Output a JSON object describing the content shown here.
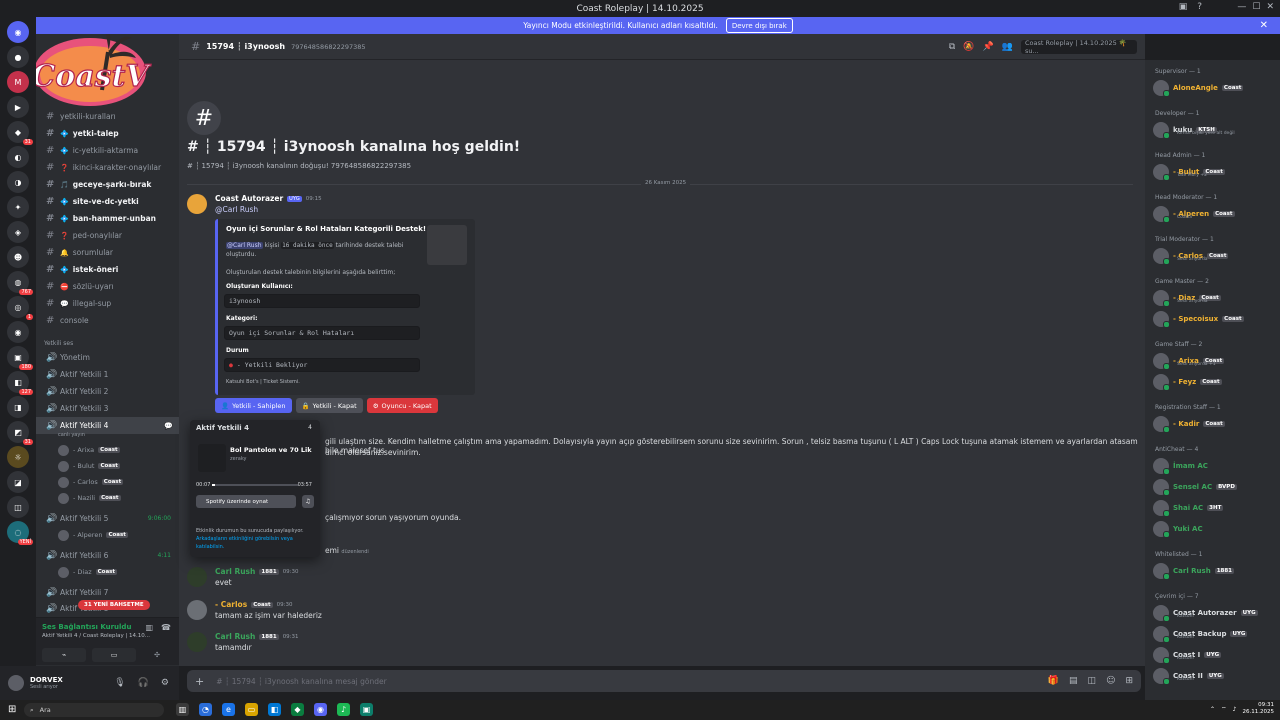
{
  "titlebar": {
    "title": "Coast Roleplay | 14.10.2025"
  },
  "streamer": {
    "text": "Yayıncı Modu etkinleştirildi. Kullanıcı adları kısaltıldı.",
    "button": "Devre dışı bırak"
  },
  "server": {
    "name": "Coast Roleplay | 14.10.2025",
    "logo_text": "CoastV"
  },
  "channel_header": {
    "name": "15794 ┆ i3ynoosh",
    "id": "797648586822297385",
    "search_placeholder": "Coast Roleplay | 14.10.2025 🌴 su..."
  },
  "channels": [
    {
      "name": "yetkili-kuralları",
      "emoji": "",
      "bold": false
    },
    {
      "name": "yetki-talep",
      "emoji": "💠",
      "bold": true
    },
    {
      "name": "ic-yetkili-aktarma",
      "emoji": "💠",
      "bold": false
    },
    {
      "name": "ikinci-karakter-onaylılar",
      "emoji": "❓",
      "bold": false
    },
    {
      "name": "geceye-şarkı-bırak",
      "emoji": "🎵",
      "bold": true
    },
    {
      "name": "site-ve-dc-yetki",
      "emoji": "💠",
      "bold": true
    },
    {
      "name": "ban-hammer-unban",
      "emoji": "💠",
      "bold": true
    },
    {
      "name": "ped-onaylılar",
      "emoji": "❓",
      "bold": false
    },
    {
      "name": "sorumlular",
      "emoji": "🔔",
      "bold": false
    },
    {
      "name": "istek-öneri",
      "emoji": "💠",
      "bold": true
    },
    {
      "name": "sözlü-uyarı",
      "emoji": "⛔",
      "bold": false
    },
    {
      "name": "illegal-sup",
      "emoji": "💬",
      "bold": false
    },
    {
      "name": "console",
      "emoji": "",
      "bold": false
    }
  ],
  "voice_category": "Yetkili ses",
  "voice_channels": {
    "yonetim": "Yönetim",
    "v1": "Aktif Yetkili 1",
    "v2": "Aktif Yetkili 2",
    "v3": "Aktif Yetkili 3",
    "v4": "Aktif Yetkili 4",
    "v4_sub": "canlı yayın",
    "v5": "Aktif Yetkili 5",
    "v5_timer": "9:06:00",
    "v6": "Aktif Yetkili 6",
    "v6_timer": "4:11",
    "v7": "Aktif Yetkili 7",
    "v8": "Aktif Yetkili 8"
  },
  "voice_users_v4": [
    {
      "name": "- Arixa",
      "tag": "Coast"
    },
    {
      "name": "- Bulut",
      "tag": "Coast"
    },
    {
      "name": "- Carlos",
      "tag": "Coast"
    },
    {
      "name": "- Nazili",
      "tag": "Coast"
    }
  ],
  "voice_users_v5": [
    {
      "name": "- Alperen",
      "tag": "Coast"
    }
  ],
  "voice_users_v6": [
    {
      "name": "- Diaz",
      "tag": "Coast"
    }
  ],
  "new_badge": "31 YENİ BAHSETME",
  "voice_panel": {
    "status": "Ses Bağlantısı Kuruldu",
    "channel": "Aktif Yetkili 4 / Coast Roleplay | 14.10..."
  },
  "user_panel": {
    "name": "DORVEX",
    "status": "Sesli arıyor"
  },
  "welcome": {
    "title": "# ┆ 15794 ┆ i3ynoosh kanalına hoş geldin!",
    "subtitle": "# ┆ 15794 ┆ i3ynoosh kanalının doğuşu! 797648586822297385",
    "date": "26 Kasım 2025"
  },
  "bot_msg": {
    "author": "Coast Autorazer",
    "badge": "UYG",
    "time": "09:15",
    "mention": "@Carl Rush",
    "embed_title": "Oyun içi Sorunlar & Rol Hataları Kategorili Destek!",
    "desc_mention": "@Carl Rush",
    "desc_1": "kişisi",
    "desc_code": "16 dakika önce",
    "desc_2": "tarihinde destek talebi oluşturdu.",
    "desc_3": "Oluşturulan destek talebinin bilgilerini aşağıda belirttim;",
    "f1_label": "Oluşturan Kullanıcı:",
    "f1_value": "i3ynoosh",
    "f2_label": "Kategori:",
    "f2_value": "Oyun içi Sorunlar & Rol Hataları",
    "f3_label": "Durum",
    "f3_value": "- Yetkili Bekliyor",
    "footer": "Katsuhi Bot's | Ticket Sistemi."
  },
  "buttons": {
    "b1": "Yetkili - Sahiplen",
    "b2": "Yetkili - Kapat",
    "b3": "Oyuncu - Kapat"
  },
  "partial_msgs": {
    "m1": "gili ulaştım size. Kendim halletme çalıştım ama yapamadım. Dolayısıyla yayın açıp gösterebilirsem sorunu size sevinirim. Sorun ,  telsiz basma tuşunu ( L ALT ) Caps Lock tuşuna atamak istemem ve ayarlardan atasam bile malesef tuş",
    "m2": "dımcı olursanız sevinirim.",
    "m3": "çalışmıyor sorun yaşıyorum oyunda.",
    "m4": "emi",
    "m4_small": "düzenlendi"
  },
  "messages": [
    {
      "author": "Carl Rush",
      "tag": "1881",
      "time": "09:30",
      "text": "evet",
      "color": "#3ba55c"
    },
    {
      "author": "- Carlos",
      "tag": "Coast",
      "time": "09:30",
      "text": "tamam az işim var halederiz",
      "color": "#f0b232"
    },
    {
      "author": "Carl Rush",
      "tag": "1881",
      "time": "09:31",
      "text": "tamamdır",
      "color": "#3ba55c"
    }
  ],
  "popup": {
    "header": "Aktif Yetkili 4",
    "count": "4",
    "song": "Bol Pantolon ve 70 Lik",
    "artist": "zeraky",
    "t_start": "00:07",
    "t_end": "03:57",
    "spotify": "Spotify üzerinde oynat",
    "note": "Etkinlik durumun bu sunucuda paylaşılıyor.",
    "note_link": "Arkadaşların etkinliğini görebilsin veya katılabilsin."
  },
  "composer": {
    "placeholder": "# ┆ 15794 ┆ i3ynoosh kanalına mesaj gönder"
  },
  "members": [
    {
      "role": "Supervisor — 1",
      "people": [
        {
          "name": "AloneAngle",
          "tag": "Coast",
          "color": "#f0b232",
          "sub": ""
        }
      ]
    },
    {
      "role": "Developer — 1",
      "people": [
        {
          "name": "kuku",
          "tag": "KTSH",
          "color": "#dbdee1",
          "sub": "Kimse bişiki yere alt değil"
        }
      ]
    },
    {
      "role": "Head Admin — 1",
      "people": [
        {
          "name": "- Bulut",
          "tag": "Coast",
          "color": "#f0b232",
          "sub": "Tate Mory +2"
        }
      ]
    },
    {
      "role": "Head Moderator — 1",
      "people": [
        {
          "name": "- Alperen",
          "tag": "Coast",
          "color": "#f0b232",
          "sub": "Coastv"
        }
      ]
    },
    {
      "role": "Trial Moderator — 1",
      "people": [
        {
          "name": "- Carlos",
          "tag": "Coast",
          "color": "#f0b232",
          "sub": "Sesli arıyorda"
        }
      ]
    },
    {
      "role": "Game Master — 2",
      "people": [
        {
          "name": "- Diaz",
          "tag": "Coast",
          "color": "#f0b232",
          "sub": "Sesli arıyorda"
        },
        {
          "name": "- Specoisux",
          "tag": "Coast",
          "color": "#f0b232",
          "sub": ""
        }
      ]
    },
    {
      "role": "Game Staff — 2",
      "people": [
        {
          "name": "- Arixa",
          "tag": "Coast",
          "color": "#f0b232",
          "sub": "Sesli arıyorda +1"
        },
        {
          "name": "- Feyz",
          "tag": "Coast",
          "color": "#f0b232",
          "sub": ""
        }
      ]
    },
    {
      "role": "Registration Staff — 1",
      "people": [
        {
          "name": "- Kadir",
          "tag": "Coast",
          "color": "#f0b232",
          "sub": ""
        }
      ]
    },
    {
      "role": "AntiCheat — 4",
      "people": [
        {
          "name": "İmam AC",
          "tag": "",
          "color": "#3ba55c",
          "sub": ""
        },
        {
          "name": "Sensel AC",
          "tag": "BVPD",
          "color": "#3ba55c",
          "sub": ""
        },
        {
          "name": "Shai AC",
          "tag": "3HT",
          "color": "#3ba55c",
          "sub": ""
        },
        {
          "name": "Yuki AC",
          "tag": "",
          "color": "#3ba55c",
          "sub": ""
        }
      ]
    },
    {
      "role": "Whitelisted — 1",
      "people": [
        {
          "name": "Carl Rush",
          "tag": "1881",
          "color": "#3ba55c",
          "sub": ""
        }
      ]
    },
    {
      "role": "Çevrim içi — 7",
      "people": [
        {
          "name": "Coast Autorazer",
          "tag": "UYG",
          "color": "#dbdee1",
          "sub": "Katsuhi"
        },
        {
          "name": "Coast Backup",
          "tag": "UYG",
          "color": "#dbdee1",
          "sub": "Katsuhi"
        },
        {
          "name": "Coast I",
          "tag": "UYG",
          "color": "#dbdee1",
          "sub": "Katsuhi"
        },
        {
          "name": "Coast II",
          "tag": "UYG",
          "color": "#dbdee1",
          "sub": "Katsuhi"
        }
      ]
    }
  ],
  "taskbar": {
    "search": "Ara",
    "time": "09:31",
    "date": "26.11.2025"
  },
  "guild_badges": [
    "31",
    "767",
    "1",
    "180",
    "127",
    "31",
    "YENİ"
  ]
}
